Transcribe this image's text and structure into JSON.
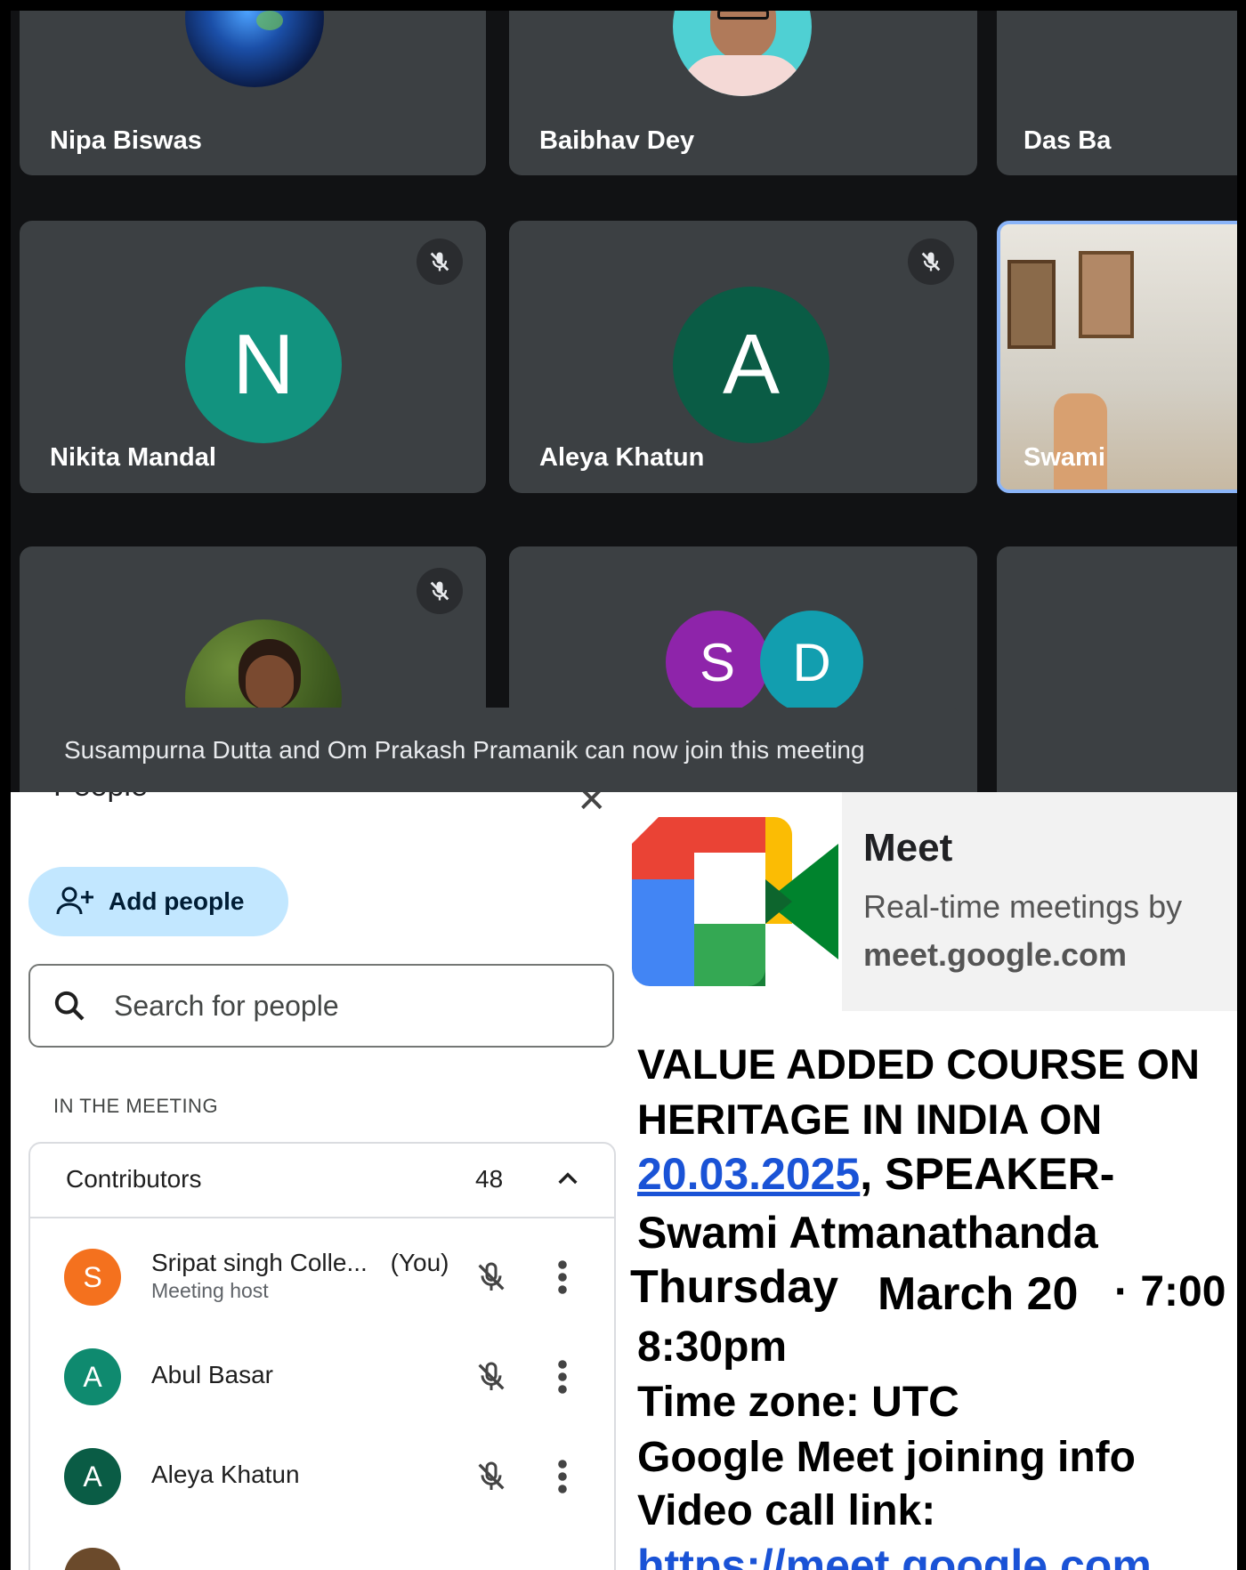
{
  "meeting_grid": {
    "tiles": [
      {
        "name": "Nipa Biswas"
      },
      {
        "name": "Baibhav Dey"
      },
      {
        "name": "Das Ba"
      },
      {
        "name": "Nikita Mandal",
        "initial": "N",
        "color": "#12937f",
        "muted": true
      },
      {
        "name": "Aleya Khatun",
        "initial": "A",
        "color": "#0a5c45",
        "muted": true
      },
      {
        "name": "Swami"
      },
      {
        "muted": true
      },
      {
        "initials": [
          "S",
          "D"
        ],
        "colors": [
          "#8e24aa",
          "#129eaf"
        ]
      }
    ],
    "toast": "Susampurna Dutta and Om Prakash Pramanik can now join this meeting"
  },
  "people_panel": {
    "title": "People",
    "add_people_label": "Add people",
    "search_placeholder": "Search for people",
    "section_label": "IN THE MEETING",
    "group_label": "Contributors",
    "group_count": "48",
    "participants": [
      {
        "initial": "S",
        "color": "#f4711e",
        "name": "Sripat singh Colle...",
        "you_label": "(You)",
        "role": "Meeting host"
      },
      {
        "initial": "A",
        "color": "#0f8a6f",
        "name": "Abul Basar"
      },
      {
        "initial": "A",
        "color": "#0a5c45",
        "name": "Aleya Khatun"
      }
    ]
  },
  "poster": {
    "meet_card": {
      "title": "Meet",
      "subtitle": "Real-time meetings by",
      "domain": "meet.google.com"
    },
    "line1": "VALUE ADDED COURSE ON",
    "line2": "HERITAGE IN INDIA ON",
    "date_link": "20.03.2025",
    "line3_rest": ", SPEAKER-",
    "line4": "Swami Atmanathanda",
    "day": "Thursday",
    "month_day": "March  20",
    "time_start": "· 7:00",
    "time_end": "8:30pm",
    "timezone": "Time zone: UTC",
    "join_info": "Google Meet joining info",
    "video_link_label": "Video call link:",
    "video_link": "https://meet.google.com"
  }
}
